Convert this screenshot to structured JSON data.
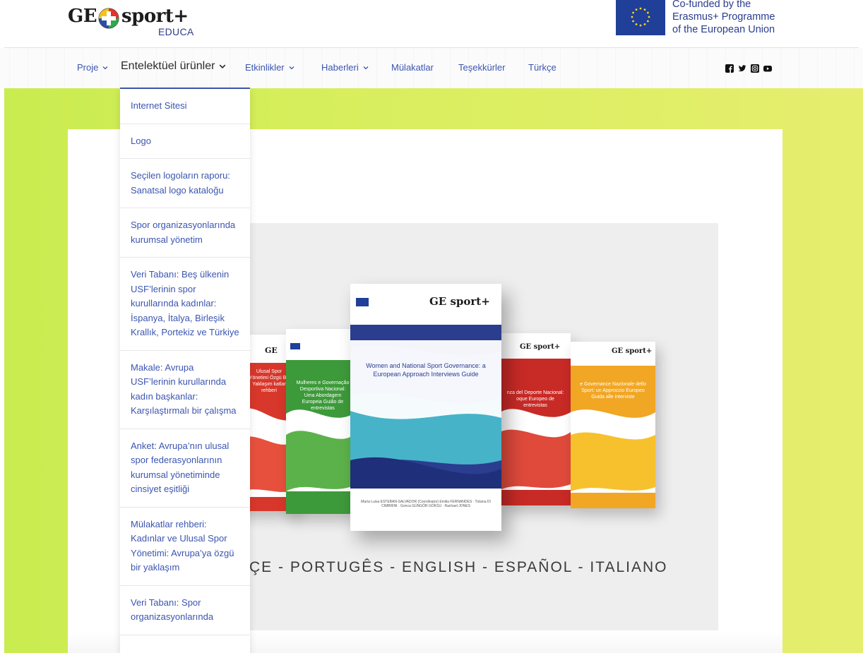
{
  "header": {
    "logo": {
      "ge": "GE",
      "sport": "sport+",
      "educa": "EDUCA"
    },
    "eu_text": [
      "Co-funded by the",
      "Erasmus+ Programme",
      "of the European Union"
    ]
  },
  "nav": {
    "items": [
      {
        "label": "Proje",
        "has_submenu": true
      },
      {
        "label": "Entelektüel ürünler",
        "has_submenu": true,
        "active": true
      },
      {
        "label": "Etkinlikler",
        "has_submenu": true
      },
      {
        "label": "Haberleri",
        "has_submenu": true
      },
      {
        "label": "Mülakatlar",
        "has_submenu": false
      },
      {
        "label": "Teşekkürler",
        "has_submenu": false
      },
      {
        "label": "Türkçe",
        "has_submenu": false
      }
    ],
    "social_icons": [
      "facebook-icon",
      "twitter-icon",
      "instagram-icon",
      "youtube-icon"
    ]
  },
  "dropdown": {
    "items": [
      "Internet Sitesi",
      "Logo",
      "Seçilen logoların raporu: Sanatsal logo kataloğu",
      "Spor organizasyonlarında kurumsal yönetim",
      "Veri Tabanı: Beş ülkenin USF’lerinin spor kurullarında kadınlar: İspanya, İtalya, Birleşik Krallık, Portekiz ve Türkiye",
      "Makale: Avrupa USF’lerinin kurullarında kadın başkanlar: Karşılaştırmalı bir çalışma",
      "Anket: Avrupa’nın ulusal spor federasyonlarının kurumsal yönetiminde cinsiyet eşitliği",
      "Mülakatlar rehberi: Kadınlar ve Ulusal Spor Yönetimi: Avrupa’ya özgü bir yaklaşım",
      "Veri Tabanı: Spor organizasyonlarında"
    ]
  },
  "feature": {
    "languages": "ÇE - PORTUGÊS - ENGLISH - ESPAÑOL - ITALIANO",
    "books": {
      "front_title": "Women and National Sport Governance: a European Approach Interviews Guide",
      "front_authors": "María Luisa ESTEBAN-SALVADOR (Coordinator) Emilia FERNANDES · Tiziana DI CIMBRINI · Gonca GÜNGÖR GÖKSU · Rachael JONES",
      "left_title": "Mulheres e Governação Desportiva Nacional: Uma Abordagem Europeia Guião de entrevistas",
      "far_left_title": "Ulusal Spor Yönetimi Özgü Bir Yaklaşım katlar rehberi",
      "right_title": "nza del Deporte Nacional: oque Europeo de entrevistas",
      "far_right_title": "e Governance Nazionale dello Sport: un Approccio Europeo Guida alle interviste",
      "cofunded_small": "Co-funded by the Erasmus+ Programme of the European Union"
    }
  },
  "colors": {
    "nav_link": "#3b55b0",
    "eu_blue": "#1f3f98",
    "bg_green": "#d4ec5a"
  }
}
